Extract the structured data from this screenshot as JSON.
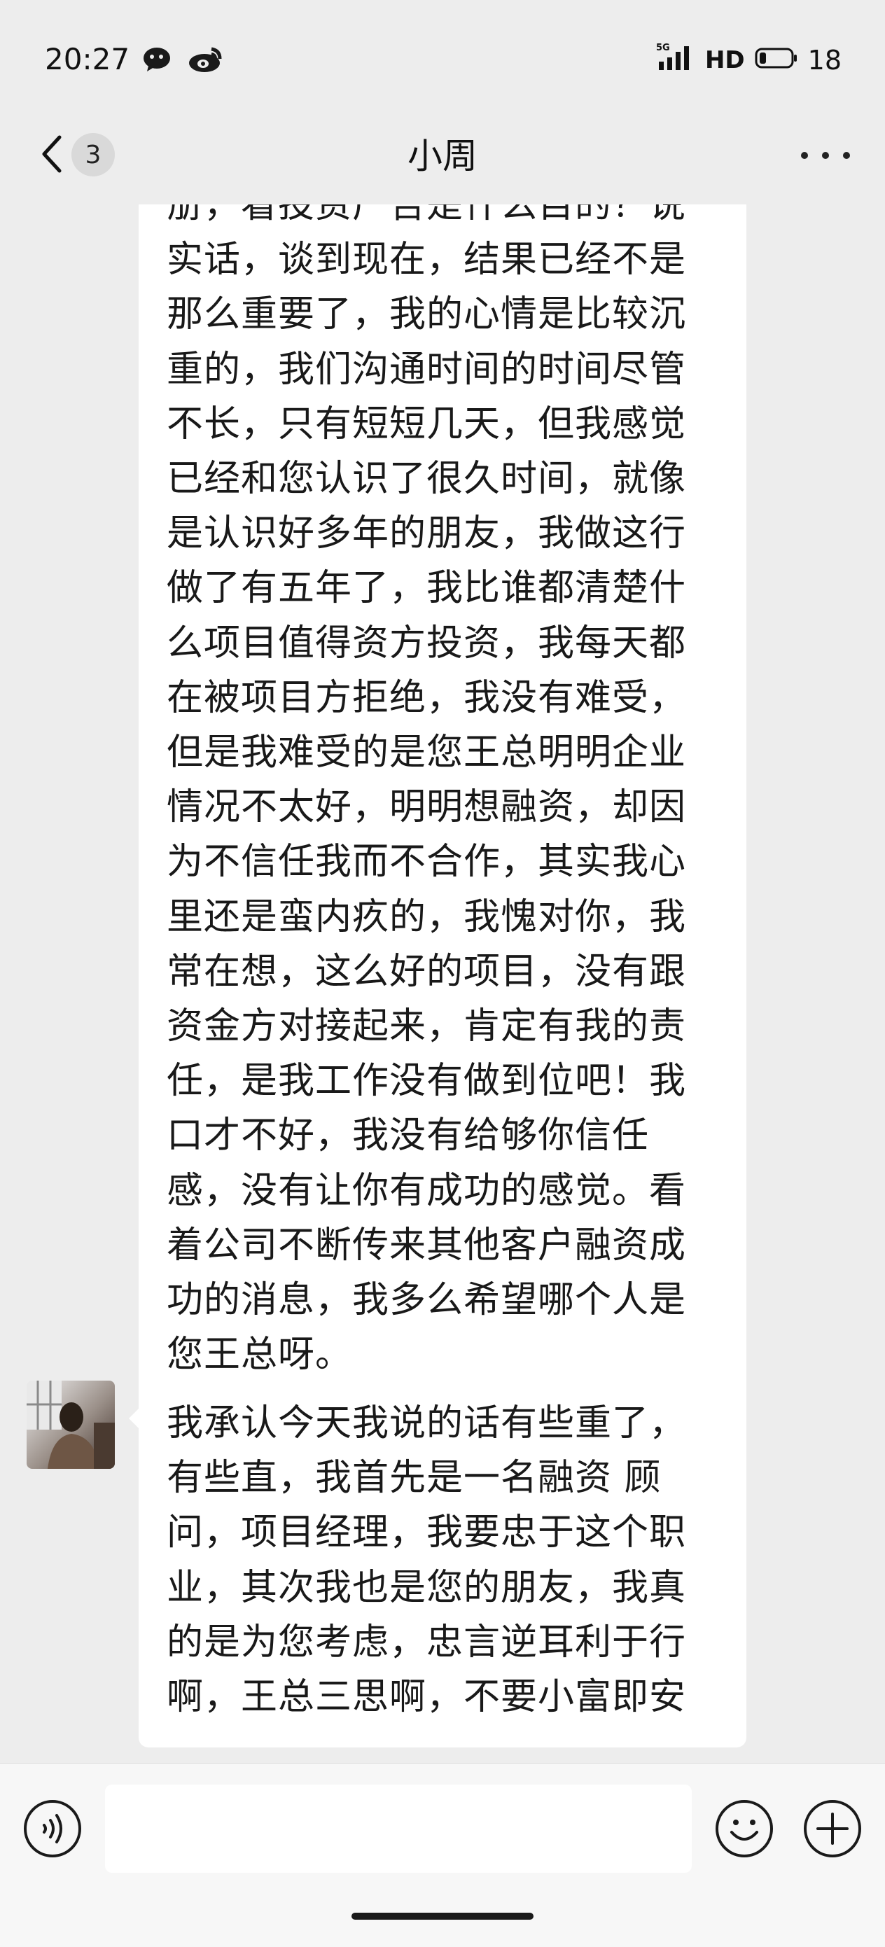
{
  "status_bar": {
    "time": "20:27",
    "network": "5G",
    "hd": "HD",
    "battery": "18",
    "icons": [
      "wechat-icon",
      "weibo-icon",
      "signal-icon",
      "battery-icon"
    ]
  },
  "nav": {
    "unread_count": "3",
    "title": "小周",
    "icons": [
      "back-chevron-icon",
      "more-dots-icon"
    ]
  },
  "messages": [
    {
      "sender": "contact",
      "text": "册，看投资广告是什么目的？说实话，谈到现在，结果已经不是那么重要了，我的心情是比较沉重的，我们沟通时间的时间尽管不长，只有短短几天，但我感觉已经和您认识了很久时间，就像是认识好多年的朋友，我做这行做了有五年了，我比谁都清楚什么项目值得资方投资，我每天都在被项目方拒绝，我没有难受，但是我难受的是您王总明明企业情况不太好，明明想融资，却因为不信任我而不合作，其实我心里还是蛮内疚的，我愧对你，我常在想，这么好的项目，没有跟资金方对接起来，肯定有我的责任，是我工作没有做到位吧！我口才不好，我没有给够你信任感，没有让你有成功的感觉。看着公司不断传来其他客户融资成功的消息，我多么希望哪个人是您王总呀。"
    },
    {
      "sender": "contact",
      "text": "我承认今天我说的话有些重了，有些直，我首先是一名融资 顾问，项目经理，我要忠于这个职业，其次我也是您的朋友，我真的是为您考虑，忠言逆耳利于行啊，王总三思啊，不要小富即安"
    }
  ],
  "input_bar": {
    "placeholder": "",
    "icons": [
      "voice-icon",
      "emoji-icon",
      "plus-icon"
    ]
  },
  "colors": {
    "background": "#ededed",
    "bubble": "#ffffff",
    "input_bar": "#f7f7f7"
  }
}
